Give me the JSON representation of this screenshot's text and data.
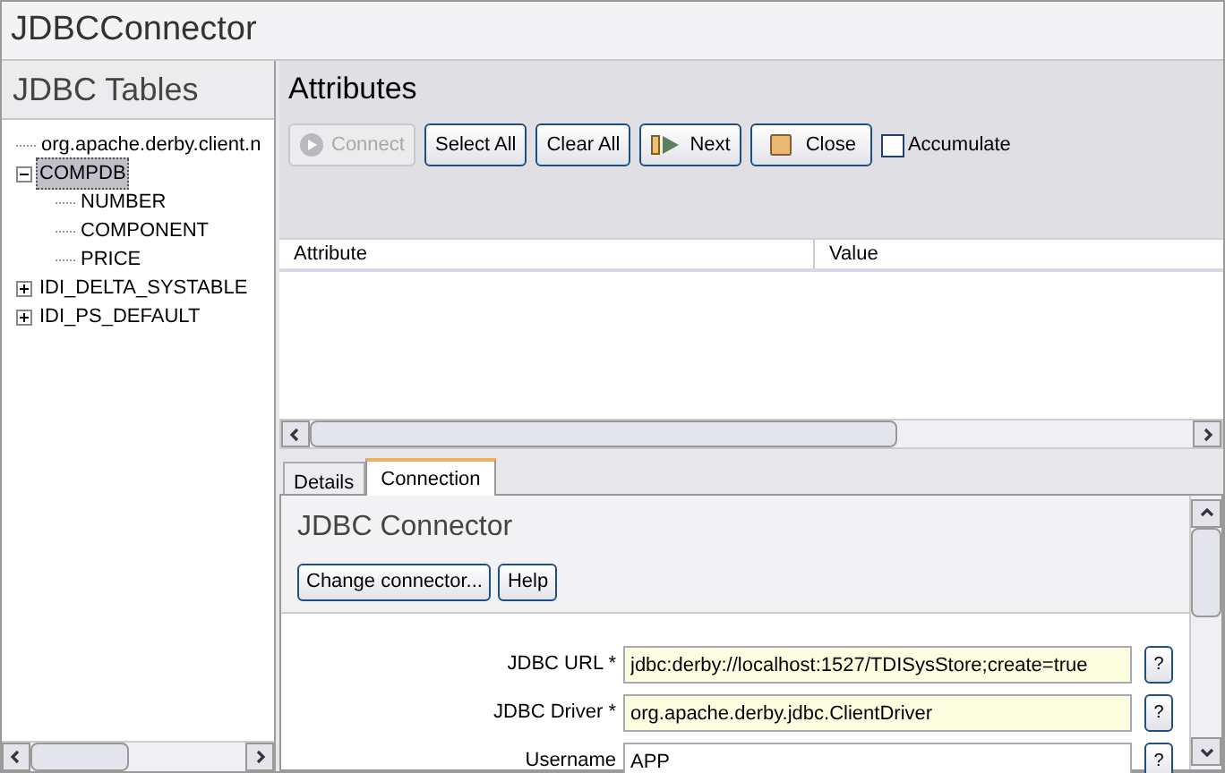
{
  "window": {
    "title": "JDBCConnector"
  },
  "tables_panel": {
    "title": "JDBC Tables",
    "tree": [
      {
        "label": "org.apache.derby.client.n",
        "selected": false
      },
      {
        "label": "COMPDB",
        "selected": true,
        "expanded": true,
        "children": [
          {
            "label": "NUMBER",
            "selected": false
          },
          {
            "label": "COMPONENT",
            "selected": false
          },
          {
            "label": "PRICE",
            "selected": false
          }
        ]
      },
      {
        "label": "IDI_DELTA_SYSTABLE",
        "selected": false,
        "expanded": false
      },
      {
        "label": "IDI_PS_DEFAULT",
        "selected": false,
        "expanded": false
      }
    ]
  },
  "attributes_panel": {
    "title": "Attributes",
    "toolbar": [
      {
        "kind": "button",
        "label": "Connect",
        "disabled": true
      },
      {
        "kind": "button",
        "label": "Select All",
        "disabled": false
      },
      {
        "kind": "button",
        "label": "Clear All",
        "disabled": false
      },
      {
        "kind": "button",
        "label": "Next",
        "disabled": false
      },
      {
        "kind": "button",
        "label": "Close",
        "disabled": false
      },
      {
        "kind": "checkbox",
        "label": "Accumulate",
        "checked": false
      }
    ],
    "table": {
      "columns": [
        "Attribute",
        "Value"
      ]
    }
  },
  "tabs": [
    {
      "label": "Details",
      "selected": false
    },
    {
      "label": "Connection",
      "selected": true
    }
  ],
  "connection": {
    "title": "JDBC Connector",
    "buttons": [
      "Change connector...",
      "Help"
    ],
    "fields": [
      {
        "label": "JDBC URL *",
        "value": "jdbc:derby://localhost:1527/TDISysStore;create=true",
        "required": true,
        "help": "?"
      },
      {
        "label": "JDBC Driver *",
        "value": "org.apache.derby.jdbc.ClientDriver",
        "required": true,
        "help": "?"
      },
      {
        "label": "Username",
        "value": "APP",
        "required": false,
        "help": "?"
      }
    ]
  }
}
